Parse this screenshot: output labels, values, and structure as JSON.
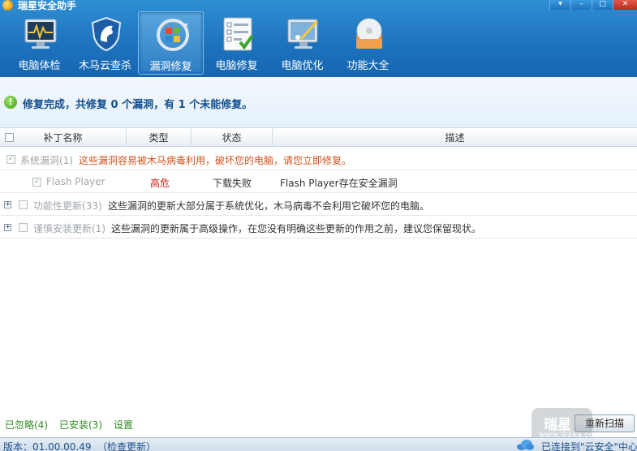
{
  "app": {
    "title": "瑞星安全助手"
  },
  "window_controls": {
    "menu": "▾",
    "minimize": "–",
    "maximize": "□",
    "close": "✕"
  },
  "toolbar": [
    {
      "label": "电脑体检",
      "icon": "monitor-pulse-icon"
    },
    {
      "label": "木马云查杀",
      "icon": "shield-horse-icon"
    },
    {
      "label": "漏洞修复",
      "icon": "windows-refresh-icon",
      "active": true
    },
    {
      "label": "电脑修复",
      "icon": "checklist-icon"
    },
    {
      "label": "电脑优化",
      "icon": "monitor-brush-icon"
    },
    {
      "label": "功能大全",
      "icon": "disc-box-icon"
    }
  ],
  "status": {
    "text": "修复完成，共修复 0 个漏洞，有 1 个未能修复。",
    "icon": "ok-check-icon"
  },
  "table": {
    "columns": [
      "补丁名称",
      "类型",
      "状态",
      "描述"
    ],
    "groups": [
      {
        "name": "系统漏洞(1)",
        "description": "这些漏洞容易被木马病毒利用，破坏您的电脑，请您立即修复。",
        "checked": true,
        "items": [
          {
            "name": "Flash Player",
            "type": "高危",
            "status": "下载失败",
            "description": "Flash Player存在安全漏洞"
          }
        ]
      },
      {
        "name": "功能性更新(33)",
        "description": "这些漏洞的更新大部分属于系统优化，木马病毒不会利用它破坏您的电脑。",
        "checked": false
      },
      {
        "name": "谨慎安装更新(1)",
        "description": "这些漏洞的更新属于高级操作，在您没有明确这些更新的作用之前，建议您保留现状。",
        "checked": false
      }
    ]
  },
  "footer": {
    "links": [
      "已忽略(4)",
      "已安装(3)",
      "设置"
    ],
    "rescan": "重新扫描",
    "watermark": {
      "brand": "瑞星",
      "url": "www.ikaka.com"
    }
  },
  "statusbar": {
    "version": "版本：01.00.00.49",
    "check_update": "（检查更新）",
    "cloud": "已连接到\"云安全\"中心"
  },
  "colors": {
    "header": "#1e74bf",
    "status_text": "#13508f",
    "orange_desc": "#d2531c",
    "risk_red": "#c8211c",
    "link_green": "#2e8b20"
  }
}
